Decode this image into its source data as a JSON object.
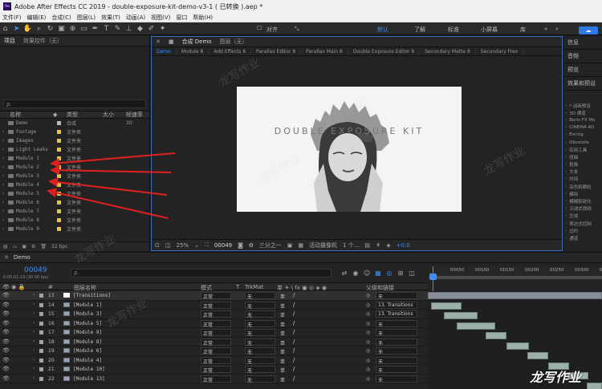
{
  "window": {
    "title": "Adobe After Effects CC 2019 - double-exposure-kit-demo-v3-1 ( 已转换 ).aep *",
    "logo_text": "Ae"
  },
  "menu": [
    "文件(F)",
    "编辑(E)",
    "合成(C)",
    "图层(L)",
    "效果(T)",
    "动画(A)",
    "视图(V)",
    "窗口",
    "帮助(H)"
  ],
  "toolbar": {
    "snap_label": "对齐",
    "workspaces": [
      "默认",
      "了解",
      "标准",
      "小屏幕",
      "库"
    ],
    "active_workspace": "默认"
  },
  "project": {
    "tabs": [
      "项目",
      "效果控件（无）"
    ],
    "search_placeholder": "ρ.",
    "headers": {
      "name": "名称",
      "type": "类型",
      "size": "大小",
      "rate": "帧速率"
    },
    "items": [
      {
        "name": "Demo",
        "type": "合成",
        "size": "30",
        "kind": "comp"
      },
      {
        "name": "Footage",
        "type": "文件夹",
        "size": "",
        "kind": "folder"
      },
      {
        "name": "Images",
        "type": "文件夹",
        "size": "",
        "kind": "folder"
      },
      {
        "name": "Light Leaks",
        "type": "文件夹",
        "size": "",
        "kind": "folder"
      },
      {
        "name": "Module 1",
        "type": "文件夹",
        "size": "",
        "kind": "folder"
      },
      {
        "name": "Module 2",
        "type": "文件夹",
        "size": "",
        "kind": "folder"
      },
      {
        "name": "Module 3",
        "type": "文件夹",
        "size": "",
        "kind": "folder"
      },
      {
        "name": "Module 4",
        "type": "文件夹",
        "size": "",
        "kind": "folder"
      },
      {
        "name": "Module 5",
        "type": "文件夹",
        "size": "",
        "kind": "folder"
      },
      {
        "name": "Module 6",
        "type": "文件夹",
        "size": "",
        "kind": "folder"
      },
      {
        "name": "Module 7",
        "type": "文件夹",
        "size": "",
        "kind": "folder"
      },
      {
        "name": "Module 8",
        "type": "文件夹",
        "size": "",
        "kind": "folder"
      },
      {
        "name": "Module 9",
        "type": "文件夹",
        "size": "",
        "kind": "folder"
      }
    ],
    "bpc": "32 bpc"
  },
  "composition": {
    "tabs": [
      "合成 Demo",
      "图层（无）"
    ],
    "view_tabs": [
      "Demo",
      "Module 8",
      "Add Effects 8",
      "Parallax Editor 8",
      "Parallax Main 8",
      "Double Exposure Editor 8",
      "Secondary Matte 8",
      "Secondary Frex"
    ],
    "frame_title": "DOUBLE EXPOSURE KIT",
    "zoom": "25%",
    "timecode": "00049",
    "resolution": "三分之一",
    "camera": "活动摄像机",
    "views": "1 个...",
    "exposure": "+0.0"
  },
  "right_panels": {
    "titles": [
      "信息",
      "音频",
      "预览",
      "效果和预设"
    ],
    "effects": [
      "* 动画预设",
      "3D 通道",
      "Boris FX Mo",
      "CINEMA 4D",
      "Exring",
      "Obsolete",
      "实用工具",
      "扭曲",
      "抠像",
      "文本",
      "时间",
      "杂色和颗粒",
      "模拟",
      "模糊和锐化",
      "沉浸式视频",
      "生成",
      "表达式控制",
      "过时",
      "通道"
    ]
  },
  "timeline": {
    "comp_tab": "Demo",
    "timecode": "00049",
    "fps": "0:00:01:19 (30.00 fps)",
    "search_placeholder": "ρ.",
    "ruler_ticks": [
      "00050",
      "00100",
      "00150",
      "00200",
      "00250",
      "00300",
      "00350"
    ],
    "headers": {
      "name": "图层名称",
      "mode": "模式",
      "t": "T",
      "trkmat": "TrkMat",
      "switches": "单 ☀ \\ fx ▣ ◎ ◈ ◉",
      "parent": "父级和链接"
    },
    "layers": [
      {
        "num": "13",
        "name": "[Transitions]",
        "mode": "正常",
        "trkmat": "无",
        "parent": "无",
        "solid": true
      },
      {
        "num": "14",
        "name": "[Module 1]",
        "mode": "正常",
        "trkmat": "无",
        "parent": "13. Transitions"
      },
      {
        "num": "15",
        "name": "[Module 3]",
        "mode": "正常",
        "trkmat": "无",
        "parent": "13. Transitions"
      },
      {
        "num": "16",
        "name": "[Module 5]",
        "mode": "正常",
        "trkmat": "无",
        "parent": "无"
      },
      {
        "num": "17",
        "name": "[Module 9]",
        "mode": "正常",
        "trkmat": "无",
        "parent": "无"
      },
      {
        "num": "18",
        "name": "[Module 8]",
        "mode": "正常",
        "trkmat": "无",
        "parent": "无"
      },
      {
        "num": "19",
        "name": "[Module 6]",
        "mode": "正常",
        "trkmat": "无",
        "parent": "无"
      },
      {
        "num": "20",
        "name": "[Module 4]",
        "mode": "正常",
        "trkmat": "无",
        "parent": "无"
      },
      {
        "num": "21",
        "name": "[Module 10]",
        "mode": "正常",
        "trkmat": "无",
        "parent": "无"
      },
      {
        "num": "22",
        "name": "[Module 13]",
        "mode": "正常",
        "trkmat": "无",
        "parent": "无"
      }
    ]
  },
  "watermark": "龙写作业",
  "colors": {
    "accent": "#3f8ef5",
    "annotation_arrow": "#e02020"
  }
}
